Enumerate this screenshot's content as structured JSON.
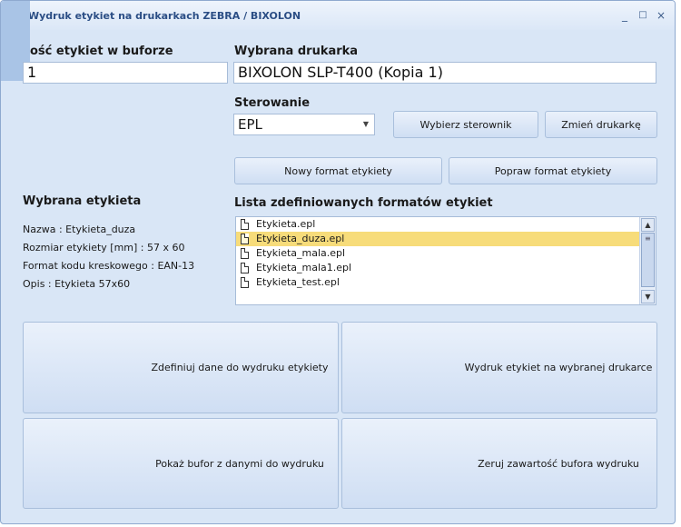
{
  "window": {
    "title": "Wydruk etykiet na drukarkach ZEBRA / BIXOLON",
    "controls": [
      "_",
      "□",
      "×"
    ]
  },
  "buffer": {
    "label": "ość etykiet w buforze",
    "value": "1"
  },
  "printer": {
    "label": "Wybrana drukarka",
    "value": "BIXOLON SLP-T400 (Kopia 1)"
  },
  "control": {
    "label": "Sterowanie",
    "value": "EPL"
  },
  "buttons": {
    "select_driver": "Wybierz sterownik",
    "change_printer": "Zmień drukarkę",
    "new_format": "Nowy format etykiety",
    "fix_format": "Popraw format etykiety",
    "define_data": "Zdefiniuj dane do wydruku etykiety",
    "print_labels": "Wydruk etykiet na wybranej drukarce",
    "show_buffer": "Pokaż bufor z danymi do wydruku",
    "clear_buffer": "Zeruj zawartość bufora wydruku"
  },
  "selected_label": {
    "heading": "Wybrana etykieta",
    "name": "Nazwa : Etykieta_duza",
    "size": "Rozmiar etykiety [mm] : 57 x 60",
    "barcode": "Format kodu kreskowego : EAN-13",
    "description": "Opis : Etykieta 57x60"
  },
  "formats": {
    "heading": "Lista zdefiniowanych formatów etykiet",
    "items": [
      "Etykieta.epl",
      "Etykieta_duza.epl",
      "Etykieta_mala.epl",
      "Etykieta_mala1.epl",
      "Etykieta_test.epl"
    ],
    "selected_index": 1
  },
  "colors": {
    "selection": "#f7dc7a",
    "title_text": "#2b4e85"
  }
}
